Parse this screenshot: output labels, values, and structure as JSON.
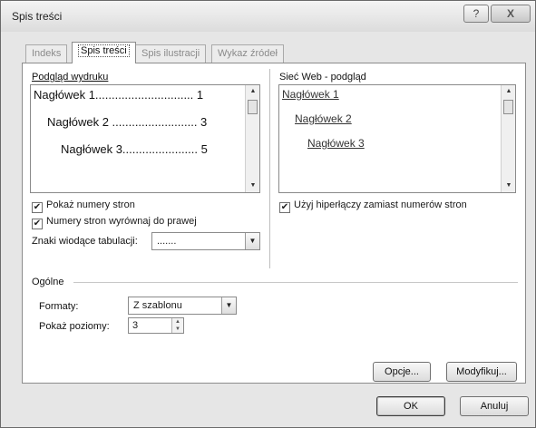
{
  "dialog": {
    "title": "Spis treści",
    "help_glyph": "?",
    "close_glyph": "X"
  },
  "tabs": [
    {
      "label": "Indeks",
      "active": false
    },
    {
      "label": "Spis treści",
      "active": true
    },
    {
      "label": "Spis ilustracji",
      "active": false
    },
    {
      "label": "Wykaz źródeł",
      "active": false
    }
  ],
  "print_preview": {
    "label": "Podgląd wydruku",
    "lines": [
      {
        "text": "Nagłówek 1.............................. 1"
      },
      {
        "text": "Nagłówek 2 .......................... 3"
      },
      {
        "text": "Nagłówek 3....................... 5"
      }
    ]
  },
  "web_preview": {
    "label": "Sieć Web - podgląd",
    "links": [
      "Nagłówek 1",
      "Nagłówek 2",
      "Nagłówek 3"
    ]
  },
  "options": {
    "show_page_numbers": {
      "label": "Pokaż numery stron",
      "checked": true
    },
    "right_align": {
      "label": "Numery stron wyrównaj do prawej",
      "checked": true
    },
    "use_hyperlinks": {
      "label": "Użyj hiperłączy zamiast numerów stron",
      "checked": true
    },
    "tab_leader": {
      "label": "Znaki wiodące tabulacji:",
      "value": "......."
    }
  },
  "general": {
    "label": "Ogólne",
    "formats": {
      "label": "Formaty:",
      "value": "Z szablonu"
    },
    "levels": {
      "label": "Pokaż poziomy:",
      "value": "3"
    }
  },
  "buttons": {
    "options": "Opcje...",
    "modify": "Modyfikuj...",
    "ok": "OK",
    "cancel": "Anuluj"
  },
  "glyphs": {
    "check": "✔",
    "arrow_up": "▲",
    "arrow_down": "▼"
  }
}
